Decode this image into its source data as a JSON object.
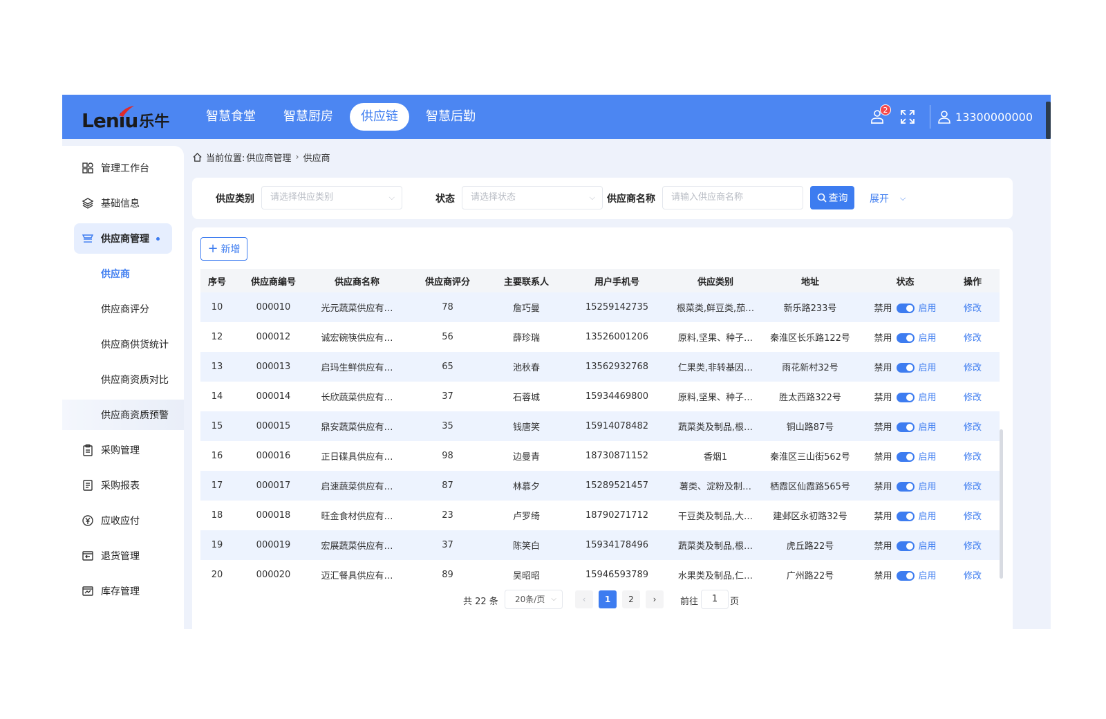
{
  "header": {
    "logo_latin": "Leniu",
    "logo_cn": "乐牛",
    "nav": [
      {
        "label": "智慧食堂",
        "active": false
      },
      {
        "label": "智慧厨房",
        "active": false
      },
      {
        "label": "供应链",
        "active": true
      },
      {
        "label": "智慧后勤",
        "active": false
      }
    ],
    "notification_count": "2",
    "username": "13300000000",
    "icons": [
      "notification-icon",
      "fullscreen-icon",
      "user-icon"
    ]
  },
  "sidebar": {
    "items": [
      {
        "label": "管理工作台",
        "icon": "dashboard-icon"
      },
      {
        "label": "基础信息",
        "icon": "layers-icon"
      },
      {
        "label": "供应商管理",
        "icon": "supplier-icon",
        "active": true
      },
      {
        "label": "采购管理",
        "icon": "clipboard-icon"
      },
      {
        "label": "采购报表",
        "icon": "report-icon"
      },
      {
        "label": "应收应付",
        "icon": "currency-icon"
      },
      {
        "label": "退货管理",
        "icon": "return-icon"
      },
      {
        "label": "库存管理",
        "icon": "inventory-icon"
      }
    ],
    "sub_items": [
      {
        "label": "供应商",
        "active": true
      },
      {
        "label": "供应商评分",
        "active": false
      },
      {
        "label": "供应商供货统计",
        "active": false
      },
      {
        "label": "供应商资质对比",
        "active": false
      },
      {
        "label": "供应商资质预警",
        "active": false
      }
    ]
  },
  "breadcrumb": {
    "prefix": "当前位置:",
    "items": [
      "供应商管理",
      "供应商"
    ]
  },
  "filters": {
    "category_label": "供应类别",
    "category_placeholder": "请选择供应类别",
    "status_label": "状态",
    "status_placeholder": "请选择状态",
    "name_label": "供应商名称",
    "name_placeholder": "请输入供应商名称",
    "query_label": "查询",
    "expand_label": "展开"
  },
  "toolbar": {
    "add_label": "新增"
  },
  "table": {
    "columns": [
      "序号",
      "供应商编号",
      "供应商名称",
      "供应商评分",
      "主要联系人",
      "用户手机号",
      "供应类别",
      "地址",
      "状态",
      "操作"
    ],
    "status_off": "禁用",
    "status_on": "启用",
    "action": "修改",
    "rows": [
      {
        "no": "10",
        "code": "000010",
        "name": "光元蔬菜供应有…",
        "score": "78",
        "contact": "詹巧曼",
        "phone": "15259142735",
        "category": "根菜类,鲜豆类,茄…",
        "address": "新乐路233号"
      },
      {
        "no": "12",
        "code": "000012",
        "name": "诚宏碗筷供应有…",
        "score": "56",
        "contact": "薛珍瑞",
        "phone": "13526001206",
        "category": "原料,坚果、种子…",
        "address": "秦淮区长乐路122号"
      },
      {
        "no": "13",
        "code": "000013",
        "name": "启玛生鲜供应有…",
        "score": "65",
        "contact": "池秋春",
        "phone": "13562932768",
        "category": "仁果类,非转基因…",
        "address": "雨花新村32号"
      },
      {
        "no": "14",
        "code": "000014",
        "name": "长欣蔬菜供应有…",
        "score": "37",
        "contact": "石蓉城",
        "phone": "15934469800",
        "category": "原料,坚果、种子…",
        "address": "胜太西路322号"
      },
      {
        "no": "15",
        "code": "000015",
        "name": "鼎安蔬菜供应有…",
        "score": "35",
        "contact": "钱唐笑",
        "phone": "15914078482",
        "category": "蔬菜类及制品,根…",
        "address": "铜山路87号"
      },
      {
        "no": "16",
        "code": "000016",
        "name": "正日碟具供应有…",
        "score": "98",
        "contact": "边曼青",
        "phone": "18730871152",
        "category": "香烟1",
        "address": "秦淮区三山街562号"
      },
      {
        "no": "17",
        "code": "000017",
        "name": "启速蔬菜供应有…",
        "score": "87",
        "contact": "林慕夕",
        "phone": "15289521457",
        "category": "薯类、淀粉及制…",
        "address": "栖霞区仙霞路565号"
      },
      {
        "no": "18",
        "code": "000018",
        "name": "旺金食材供应有…",
        "score": "23",
        "contact": "卢罗绮",
        "phone": "18790271712",
        "category": "干豆类及制品,大…",
        "address": "建邺区永初路32号"
      },
      {
        "no": "19",
        "code": "000019",
        "name": "宏展蔬菜供应有…",
        "score": "37",
        "contact": "陈笑白",
        "phone": "15934178496",
        "category": "蔬菜类及制品,根…",
        "address": "虎丘路22号"
      },
      {
        "no": "20",
        "code": "000020",
        "name": "迈汇餐具供应有…",
        "score": "89",
        "contact": "吴昭昭",
        "phone": "15946593789",
        "category": "水果类及制品,仁…",
        "address": "广州路22号"
      }
    ]
  },
  "pagination": {
    "total": "共 22 条",
    "page_size": "20条/页",
    "pages": [
      "1",
      "2"
    ],
    "current": "1",
    "goto_prefix": "前往",
    "goto_value": "1",
    "goto_suffix": "页"
  },
  "colors": {
    "primary": "#3d7cf0",
    "topbar": "#4c86f2",
    "badge": "#f5484b",
    "row_striped": "#edf3fe"
  }
}
